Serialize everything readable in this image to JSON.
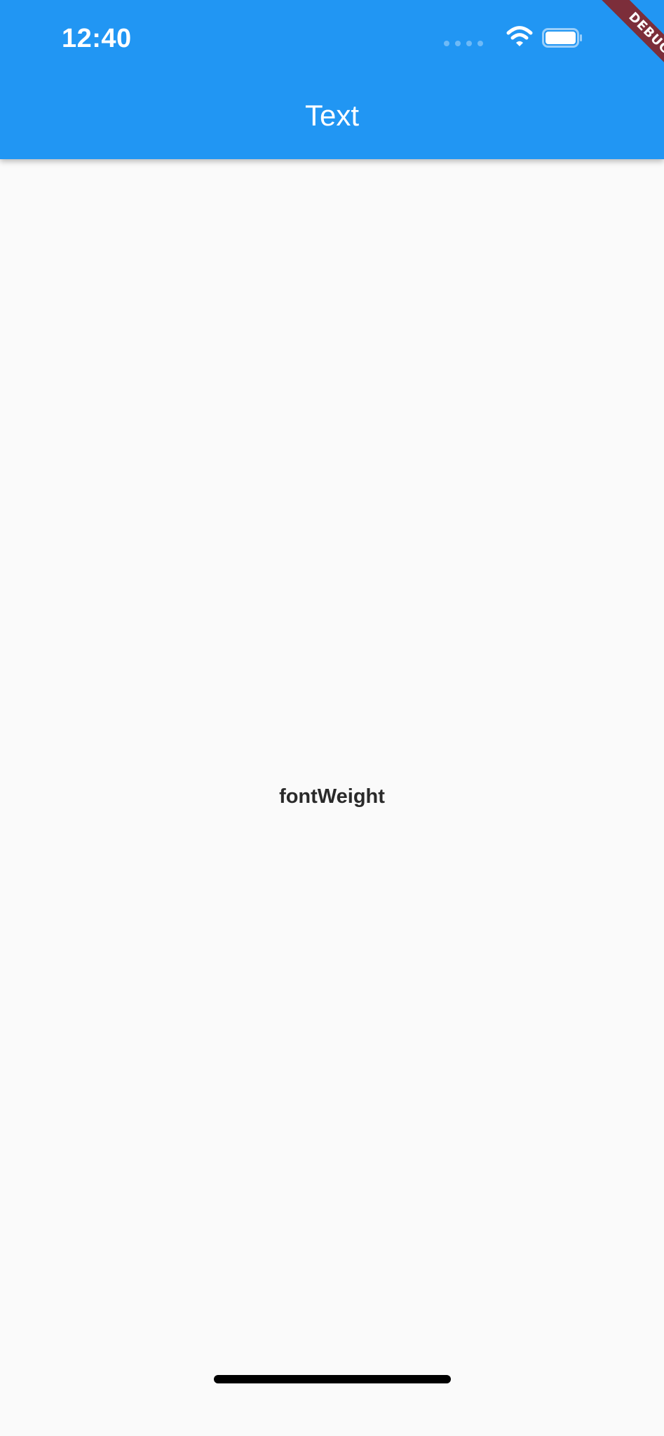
{
  "status_bar": {
    "time": "12:40",
    "icons": [
      "signal-icon",
      "wifi-icon",
      "battery-icon"
    ]
  },
  "app_bar": {
    "title": "Text",
    "color": "#2196f3"
  },
  "debug_banner": {
    "label": "DEBUG",
    "color": "#7c2e3a"
  },
  "content": {
    "text": "fontWeight"
  },
  "colors": {
    "background": "#fafafa",
    "text": "#2a2a2a"
  }
}
